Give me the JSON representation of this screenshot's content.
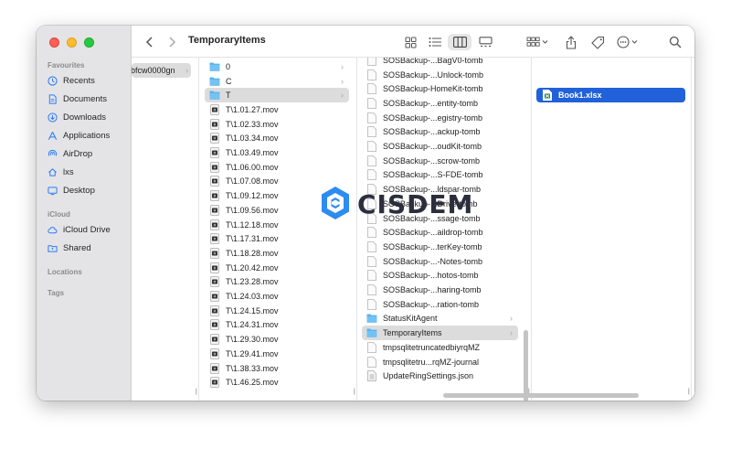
{
  "window": {
    "title": "TemporaryItems"
  },
  "sidebar": {
    "sections": [
      {
        "label": "Favourites"
      },
      {
        "label": "iCloud"
      },
      {
        "label": "Locations"
      },
      {
        "label": "Tags"
      }
    ],
    "favourites": [
      {
        "label": "Recents",
        "icon": "clock-icon"
      },
      {
        "label": "Documents",
        "icon": "document-icon"
      },
      {
        "label": "Downloads",
        "icon": "download-icon"
      },
      {
        "label": "Applications",
        "icon": "applications-icon"
      },
      {
        "label": "AirDrop",
        "icon": "airdrop-icon"
      },
      {
        "label": "lxs",
        "icon": "home-icon"
      },
      {
        "label": "Desktop",
        "icon": "desktop-icon"
      }
    ],
    "icloud": [
      {
        "label": "iCloud Drive",
        "icon": "cloud-icon"
      },
      {
        "label": "Shared",
        "icon": "shared-folder-icon"
      }
    ]
  },
  "columns": {
    "col1": {
      "selected": "bfcw0000gn"
    },
    "col2": [
      {
        "name": "0",
        "type": "folder"
      },
      {
        "name": "C",
        "type": "folder"
      },
      {
        "name": "T",
        "type": "folder",
        "selected": true
      },
      {
        "name": "T\\1.01.27.mov",
        "type": "mov"
      },
      {
        "name": "T\\1.02.33.mov",
        "type": "mov"
      },
      {
        "name": "T\\1.03.34.mov",
        "type": "mov"
      },
      {
        "name": "T\\1.03.49.mov",
        "type": "mov"
      },
      {
        "name": "T\\1.06.00.mov",
        "type": "mov"
      },
      {
        "name": "T\\1.07.08.mov",
        "type": "mov"
      },
      {
        "name": "T\\1.09.12.mov",
        "type": "mov"
      },
      {
        "name": "T\\1.09.56.mov",
        "type": "mov"
      },
      {
        "name": "T\\1.12.18.mov",
        "type": "mov"
      },
      {
        "name": "T\\1.17.31.mov",
        "type": "mov"
      },
      {
        "name": "T\\1.18.28.mov",
        "type": "mov"
      },
      {
        "name": "T\\1.20.42.mov",
        "type": "mov"
      },
      {
        "name": "T\\1.23.28.mov",
        "type": "mov"
      },
      {
        "name": "T\\1.24.03.mov",
        "type": "mov"
      },
      {
        "name": "T\\1.24.15.mov",
        "type": "mov"
      },
      {
        "name": "T\\1.24.31.mov",
        "type": "mov"
      },
      {
        "name": "T\\1.29.30.mov",
        "type": "mov"
      },
      {
        "name": "T\\1.29.41.mov",
        "type": "mov"
      },
      {
        "name": "T\\1.38.33.mov",
        "type": "mov"
      },
      {
        "name": "T\\1.46.25.mov",
        "type": "mov"
      }
    ],
    "col3": [
      {
        "name": "SOSBackup-...BagV0-tomb",
        "type": "file"
      },
      {
        "name": "SOSBackup-...Unlock-tomb",
        "type": "file"
      },
      {
        "name": "SOSBackup-HomeKit-tomb",
        "type": "file"
      },
      {
        "name": "SOSBackup-...entity-tomb",
        "type": "file"
      },
      {
        "name": "SOSBackup-...egistry-tomb",
        "type": "file"
      },
      {
        "name": "SOSBackup-...ackup-tomb",
        "type": "file"
      },
      {
        "name": "SOSBackup-...oudKit-tomb",
        "type": "file"
      },
      {
        "name": "SOSBackup-...scrow-tomb",
        "type": "file"
      },
      {
        "name": "SOSBackup-...S-FDE-tomb",
        "type": "file"
      },
      {
        "name": "SOSBackup-...ldspar-tomb",
        "type": "file"
      },
      {
        "name": "SOSBackup-...Drive-tomb",
        "type": "file"
      },
      {
        "name": "SOSBackup-...ssage-tomb",
        "type": "file"
      },
      {
        "name": "SOSBackup-...aildrop-tomb",
        "type": "file"
      },
      {
        "name": "SOSBackup-...terKey-tomb",
        "type": "file"
      },
      {
        "name": "SOSBackup-...-Notes-tomb",
        "type": "file"
      },
      {
        "name": "SOSBackup-...hotos-tomb",
        "type": "file"
      },
      {
        "name": "SOSBackup-...haring-tomb",
        "type": "file"
      },
      {
        "name": "SOSBackup-...ration-tomb",
        "type": "file"
      },
      {
        "name": "StatusKitAgent",
        "type": "folder"
      },
      {
        "name": "TemporaryItems",
        "type": "folder",
        "selected": true
      },
      {
        "name": "tmpsqlitetruncatedbiyrqMZ",
        "type": "file"
      },
      {
        "name": "tmpsqlitetru...rqMZ-journal",
        "type": "file"
      },
      {
        "name": "UpdateRingSettings.json",
        "type": "json"
      }
    ],
    "col4": [
      {
        "name": "Book1.xlsx",
        "type": "xlsx",
        "selected": true
      }
    ]
  },
  "watermark": {
    "text": "CISDEM"
  },
  "colors": {
    "accent": "#2161d9",
    "folder": "#5ab3ee",
    "sidebar": "#e4e4e6"
  }
}
